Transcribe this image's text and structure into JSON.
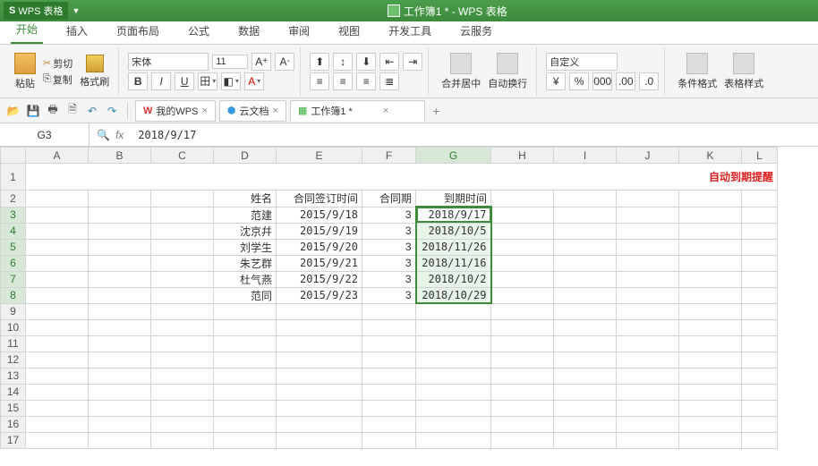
{
  "app": {
    "name": "WPS 表格",
    "doc_title": "工作簿1 * - WPS 表格"
  },
  "menu": {
    "items": [
      "开始",
      "插入",
      "页面布局",
      "公式",
      "数据",
      "审阅",
      "视图",
      "开发工具",
      "云服务"
    ],
    "active": 0
  },
  "ribbon": {
    "paste": "粘贴",
    "cut": "剪切",
    "copy": "复制",
    "format_painter": "格式刷",
    "font_name": "宋体",
    "font_size": "11",
    "merge_center": "合并居中",
    "wrap_text": "自动换行",
    "number_format": "自定义",
    "cond_format": "条件格式",
    "table_style": "表格样式"
  },
  "tabs": {
    "mywps": "我的WPS",
    "cloud": "云文档",
    "workbook": "工作簿1 *"
  },
  "formula": {
    "cell_ref": "G3",
    "value": "2018/9/17"
  },
  "sheet": {
    "columns": [
      "A",
      "B",
      "C",
      "D",
      "E",
      "F",
      "G",
      "H",
      "I",
      "J",
      "K",
      "L"
    ],
    "title": "自动到期提醒",
    "headers": {
      "D": "姓名",
      "E": "合同签订时间",
      "F": "合同期",
      "G": "到期时间"
    },
    "rows": [
      {
        "name": "范建",
        "sign": "2015/9/18",
        "term": 3,
        "due": "2018/9/17"
      },
      {
        "name": "沈京幷",
        "sign": "2015/9/19",
        "term": 3,
        "due": "2018/10/5"
      },
      {
        "name": "刘学生",
        "sign": "2015/9/20",
        "term": 3,
        "due": "2018/11/26"
      },
      {
        "name": "朱艺群",
        "sign": "2015/9/21",
        "term": 3,
        "due": "2018/11/16"
      },
      {
        "name": "杜气燕",
        "sign": "2015/9/22",
        "term": 3,
        "due": "2018/10/2"
      },
      {
        "name": "范同",
        "sign": "2015/9/23",
        "term": 3,
        "due": "2018/10/29"
      }
    ],
    "selection": {
      "active": "G3",
      "range": "G3:G8"
    }
  }
}
